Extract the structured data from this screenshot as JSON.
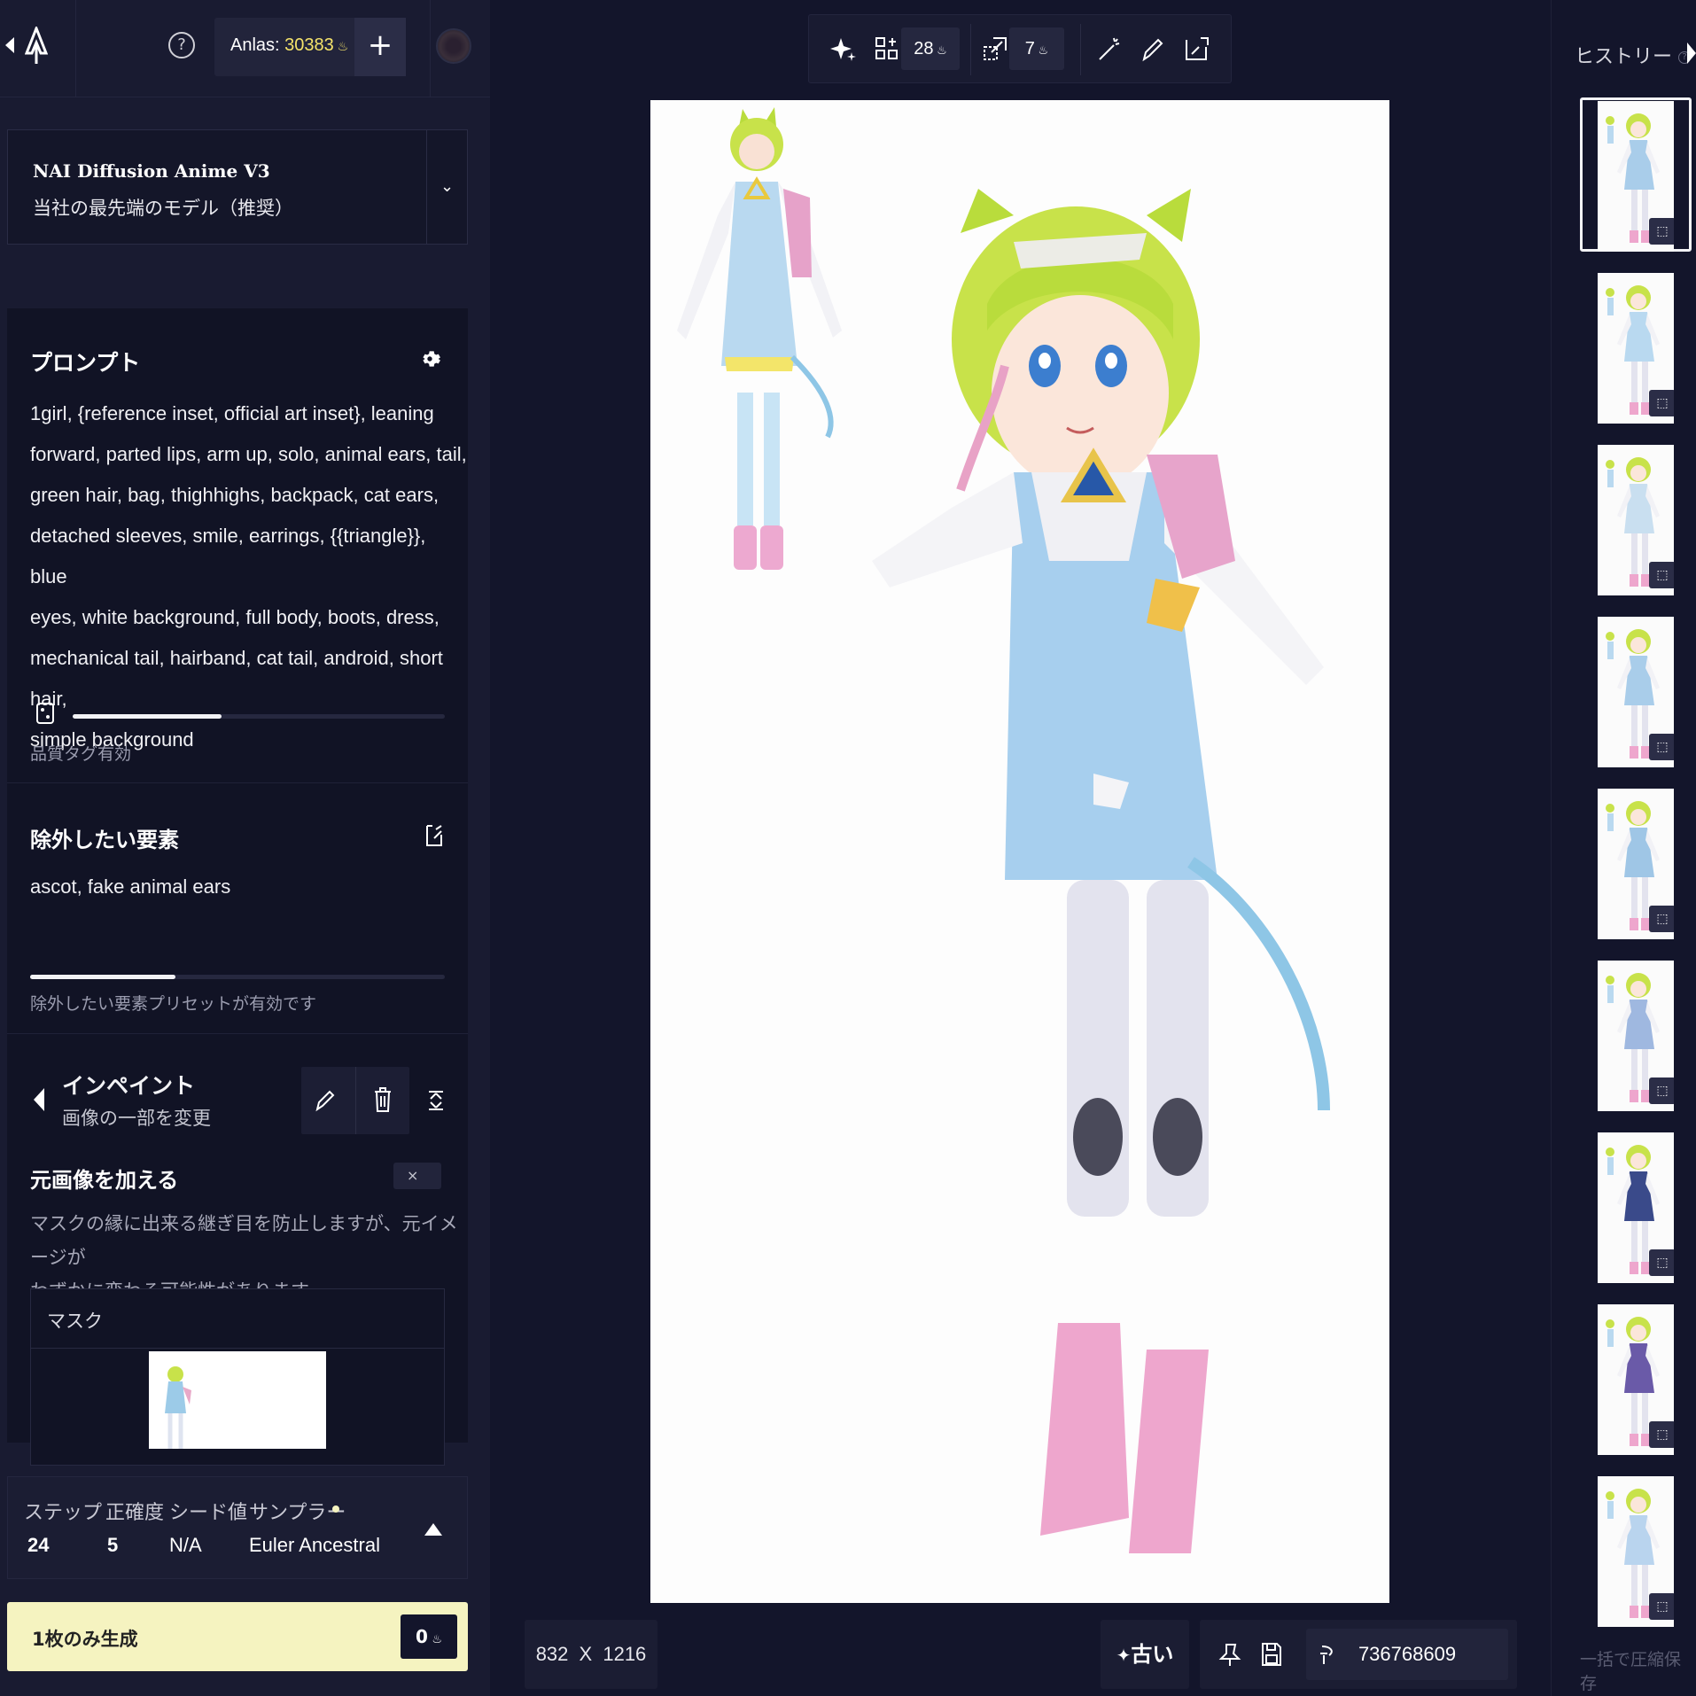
{
  "topbar": {
    "help_glyph": "?",
    "anlas_label": "Anlas:",
    "anlas_value": "30383",
    "add_glyph": "+"
  },
  "model": {
    "name": "NAI Diffusion Anime V3",
    "description": "当社の最先端のモデル（推奨）"
  },
  "prompt": {
    "title": "プロンプト",
    "lines": [
      "1girl, {reference inset, official art inset}, leaning",
      "forward, parted lips, arm up, solo, animal ears, tail,",
      "green hair, bag, thighhighs, backpack, cat ears,",
      "detached sleeves, smile, earrings, {{triangle}}, blue",
      "eyes, white background, full body, boots, dress,",
      "mechanical tail, hairband, cat tail, android, short hair,",
      "simple background"
    ],
    "quality_label": "品質タグ有効",
    "slider_fraction": 0.4
  },
  "negative": {
    "title": "除外したい要素",
    "text": "ascot, fake animal ears",
    "preset_label": "除外したい要素プリセットが有効です",
    "slider_fraction": 0.35
  },
  "inpaint": {
    "title": "インペイント",
    "subtitle": "画像の一部を変更",
    "add_original_title": "元画像を加える",
    "close_glyph": "×",
    "description_line1": "マスクの縁に出来る継ぎ目を防止しますが、元イメージが",
    "description_line2": "わずかに変わる可能性があります。",
    "mask_label": "マスク"
  },
  "settings": {
    "steps_label": "ステップ",
    "steps_value": "24",
    "guidance_label": "正確度",
    "guidance_value": "5",
    "seed_label": "シード値",
    "seed_value": "N/A",
    "sampler_label": "サンプラー",
    "sampler_value": "Euler Ancestral"
  },
  "generate": {
    "label": "1枚のみ生成",
    "cost": "0"
  },
  "toolbar": {
    "upscale_cost": "28",
    "variation_cost": "7"
  },
  "canvas": {
    "width": "832",
    "times": "X",
    "height": "1216",
    "old_label": "古い",
    "seed": "736768609"
  },
  "history": {
    "title": "ヒストリー",
    "help_glyph": "?",
    "bulk_save": "一括で圧縮保存"
  },
  "colors": {
    "background": "#13152b",
    "panel": "#191b31",
    "generate_button": "#f5f3c0",
    "anlas_gold": "#f5e36a"
  }
}
